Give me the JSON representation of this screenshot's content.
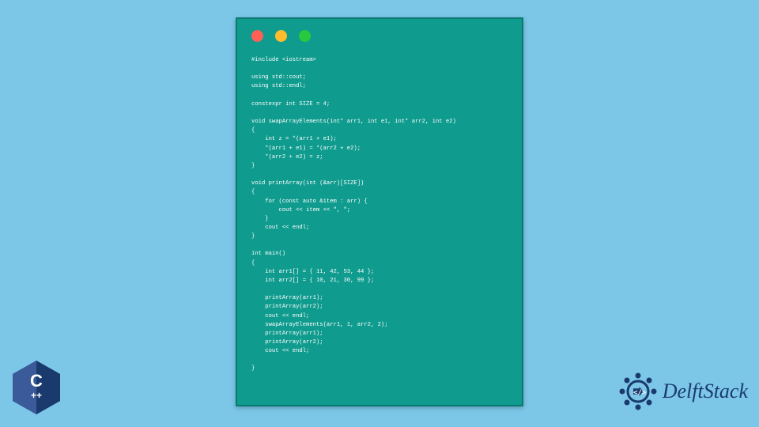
{
  "code": {
    "lines": "#include <iostream>\n\nusing std::cout;\nusing std::endl;\n\nconstexpr int SIZE = 4;\n\nvoid swapArrayElements(int* arr1, int e1, int* arr2, int e2)\n{\n    int z = *(arr1 + e1);\n    *(arr1 + e1) = *(arr2 + e2);\n    *(arr2 + e2) = z;\n}\n\nvoid printArray(int (&arr)[SIZE])\n{\n    for (const auto &item : arr) {\n        cout << item << \", \";\n    }\n    cout << endl;\n}\n\nint main()\n{\n    int arr1[] = { 11, 42, 53, 44 };\n    int arr2[] = { 10, 21, 30, 99 };\n\n    printArray(arr1);\n    printArray(arr2);\n    cout << endl;\n    swapArrayElements(arr1, 1, arr2, 2);\n    printArray(arr1);\n    printArray(arr2);\n    cout << endl;\n\n}"
  },
  "badges": {
    "cpp_label": "C++",
    "brand_label": "DelftStack"
  },
  "colors": {
    "bg": "#7cc7e8",
    "window": "#0f9b8e",
    "brand": "#1a3a6e"
  }
}
